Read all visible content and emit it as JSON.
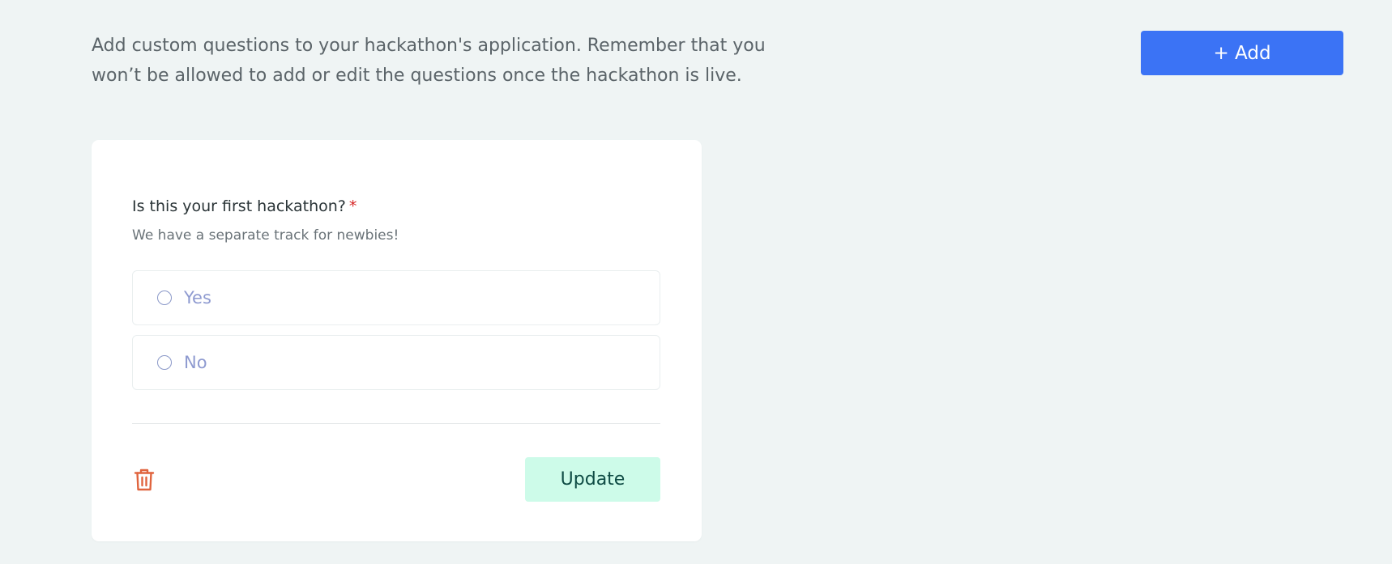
{
  "intro": {
    "text": "Add custom questions to your hackathon's application. Remember that you won’t be allowed to add or edit the questions once the hackathon is live."
  },
  "add_button": {
    "label": "+ Add"
  },
  "question": {
    "title": "Is this your first hackathon?",
    "required_marker": "*",
    "description": "We have a separate track for newbies!",
    "options": [
      {
        "label": "Yes"
      },
      {
        "label": "No"
      }
    ]
  },
  "actions": {
    "delete_icon": "trash-icon",
    "update_label": "Update"
  },
  "colors": {
    "background": "#eff4f4",
    "primary": "#3b73f5",
    "update_bg": "#cdfbe9",
    "update_text": "#0f4c45",
    "delete": "#e0643e",
    "required": "#d62525"
  }
}
